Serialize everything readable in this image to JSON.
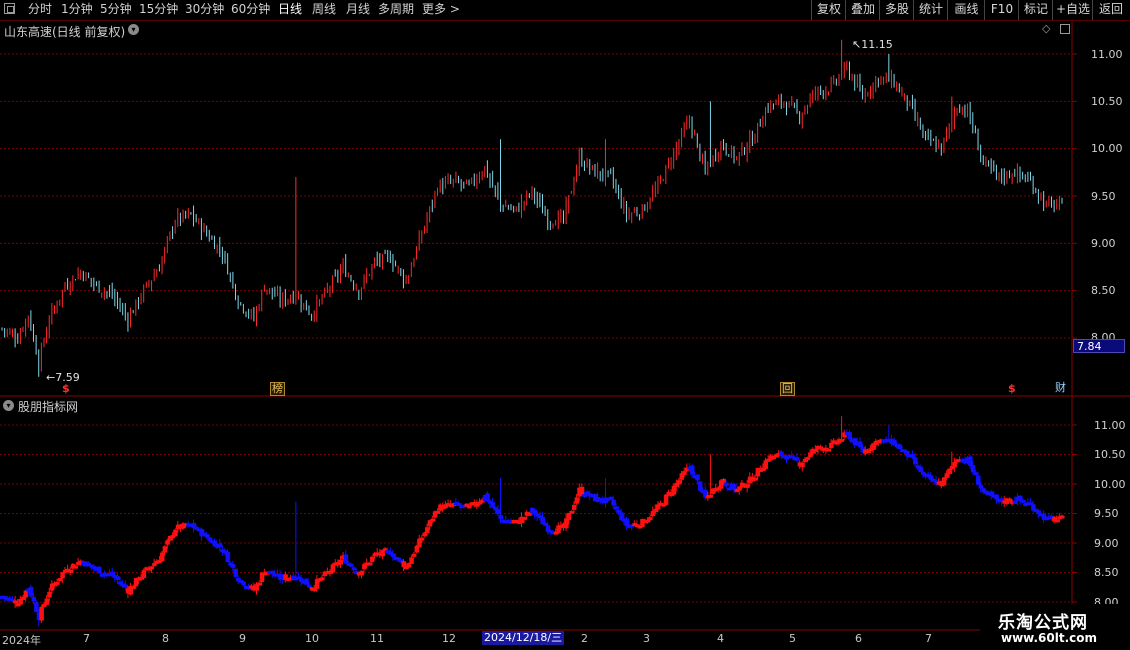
{
  "toolbar": {
    "periods": [
      "分时",
      "1分钟",
      "5分钟",
      "15分钟",
      "30分钟",
      "60分钟",
      "日线",
      "周线",
      "月线",
      "多周期",
      "更多 >"
    ],
    "active_period": "日线",
    "right_buttons": [
      "复权",
      "叠加",
      "多股",
      "统计",
      "画线",
      "F10",
      "标记",
      "+自选",
      "返回"
    ]
  },
  "main_panel": {
    "title": "山东高速(日线 前复权)",
    "high_label": "11.15",
    "low_label": "7.59",
    "price_tag": "7.84",
    "y_labels": [
      "11.00",
      "10.50",
      "10.00",
      "9.50",
      "9.00",
      "8.50",
      "8.00"
    ],
    "markers": [
      {
        "label": "$",
        "style": "red"
      },
      {
        "label": "榜",
        "style": "box"
      },
      {
        "label": "回",
        "style": "box"
      },
      {
        "label": "$",
        "style": "red"
      },
      {
        "label": "财",
        "style": "blue"
      }
    ]
  },
  "sub_panel": {
    "title": "股朋指标网",
    "y_labels": [
      "11.00",
      "10.50",
      "10.00",
      "9.50",
      "9.00",
      "8.50",
      "8.00"
    ]
  },
  "x_axis": {
    "labels": [
      "2024年",
      "7",
      "8",
      "9",
      "10",
      "11",
      "12",
      "3",
      "4",
      "5",
      "6",
      "7"
    ],
    "highlight_date": "2024/12/18/三",
    "highlight_after": "2"
  },
  "colors": {
    "up": "#ff2a2a",
    "down": "#7fd8e8",
    "sub_up": "#ff1010",
    "sub_down": "#1010ff",
    "grid": "#7a0000"
  },
  "watermark": {
    "name": "乐淘公式网",
    "url": "www.60lt.com"
  }
}
